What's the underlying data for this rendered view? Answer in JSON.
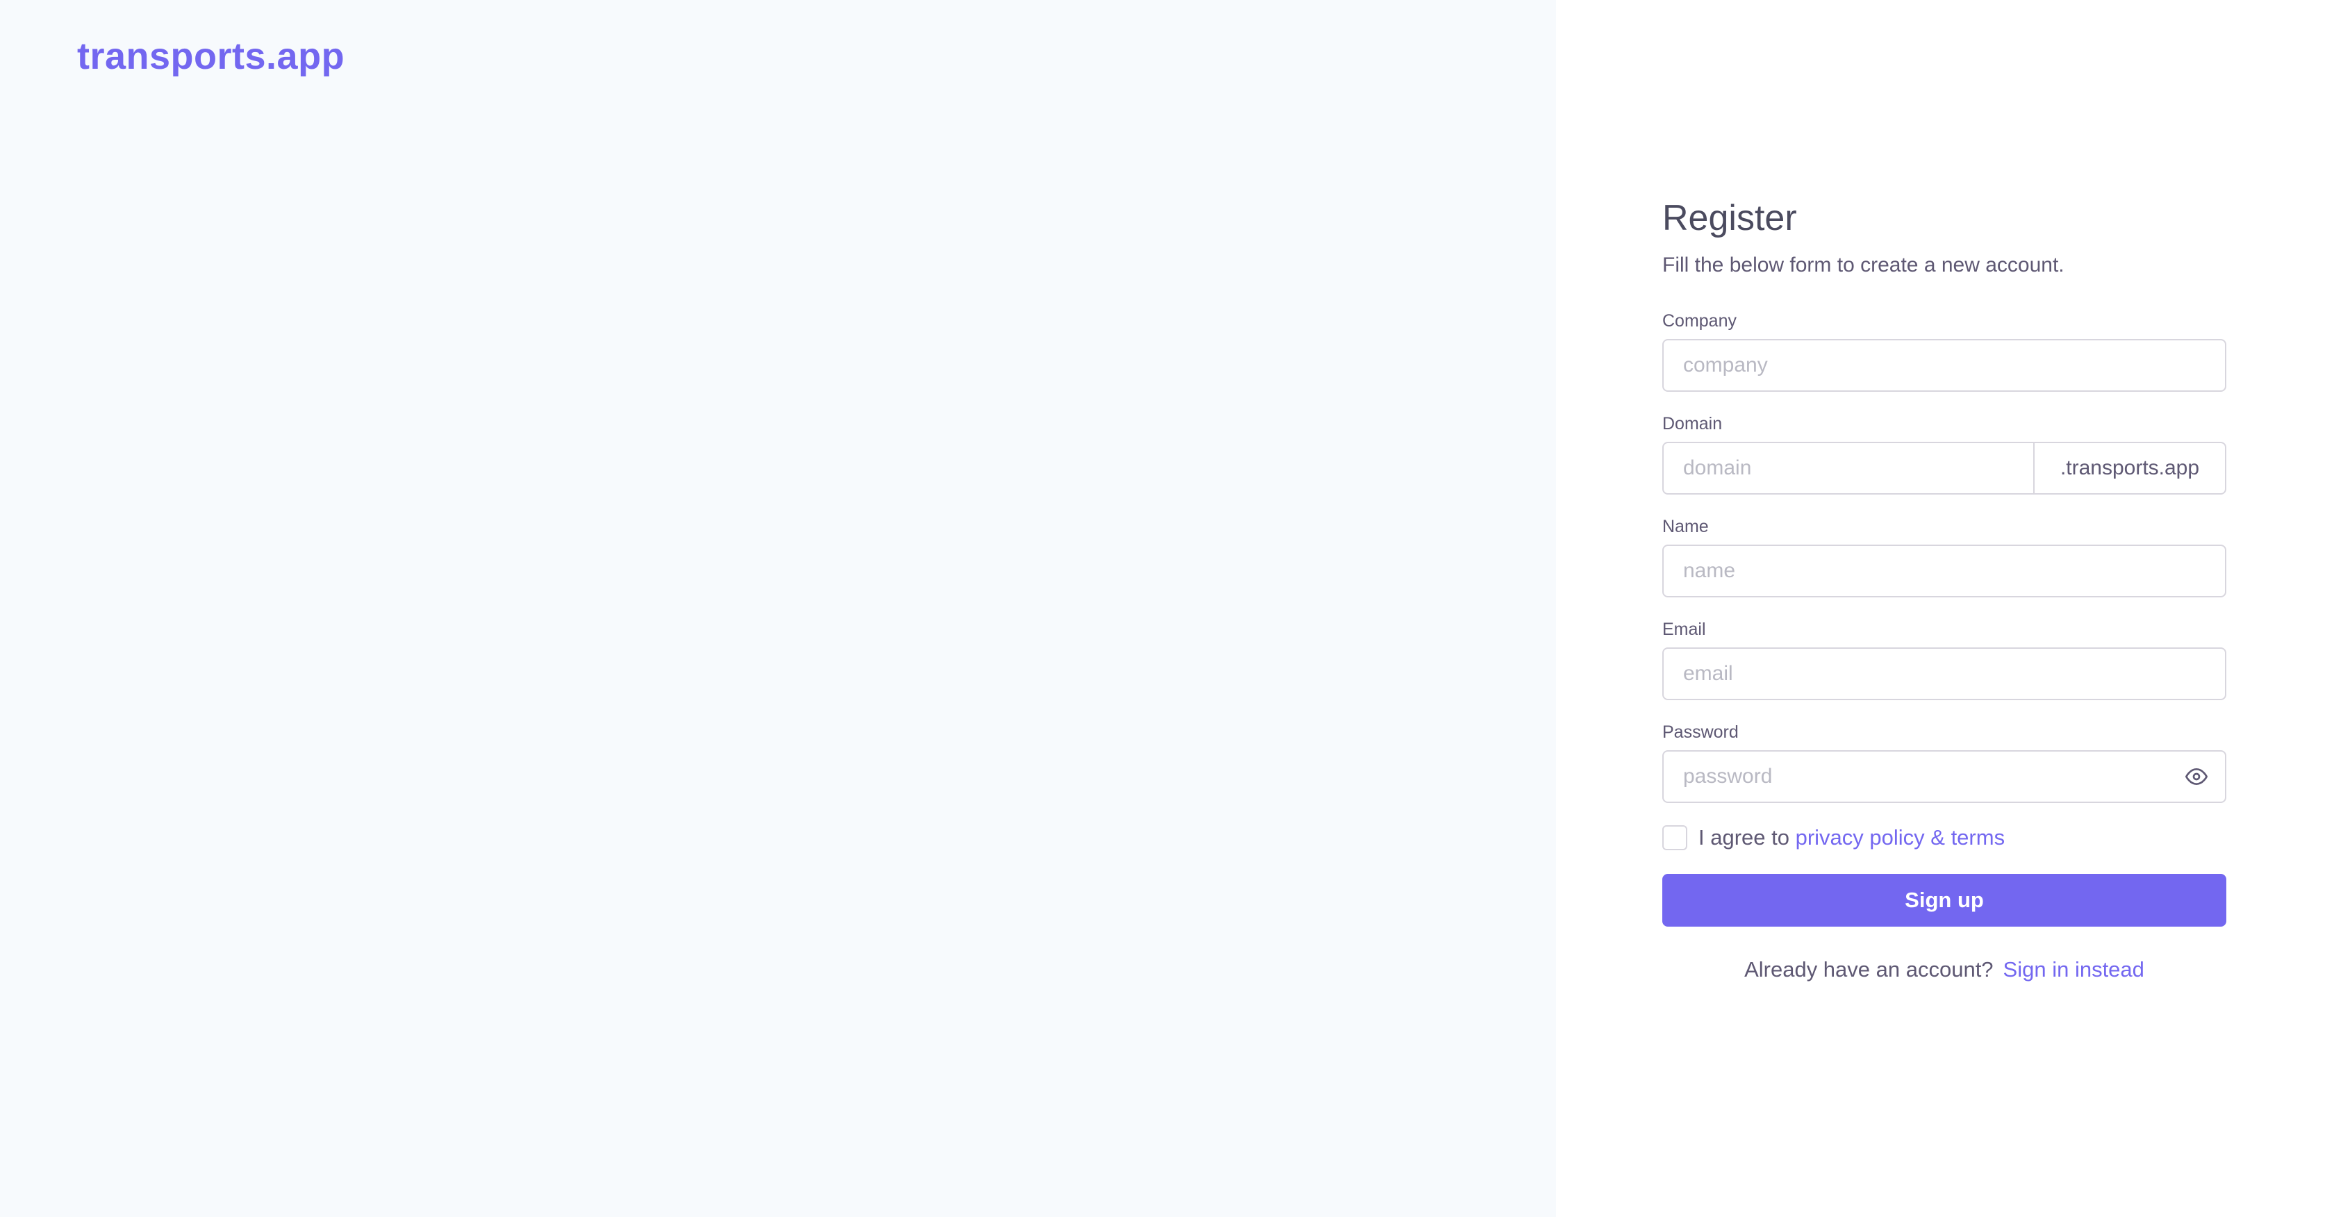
{
  "brand": {
    "name": "transports.app"
  },
  "register": {
    "title": "Register",
    "subtitle": "Fill the below form to create a new account.",
    "fields": {
      "company": {
        "label": "Company",
        "placeholder": "company",
        "value": ""
      },
      "domain": {
        "label": "Domain",
        "placeholder": "domain",
        "value": "",
        "suffix": ".transports.app"
      },
      "name": {
        "label": "Name",
        "placeholder": "name",
        "value": ""
      },
      "email": {
        "label": "Email",
        "placeholder": "email",
        "value": ""
      },
      "password": {
        "label": "Password",
        "placeholder": "password",
        "value": "",
        "toggle_icon": "eye-icon"
      }
    },
    "agree": {
      "prefix": "I agree to",
      "link_text": "privacy policy & terms",
      "checked": false
    },
    "submit_label": "Sign up",
    "signin": {
      "prompt": "Already have an account?",
      "link_text": "Sign in instead"
    }
  },
  "colors": {
    "accent": "#7367f0",
    "left_background": "#f7fafd",
    "border": "#d8d6de",
    "text": "#5e5873",
    "placeholder": "#b9b9c3"
  }
}
